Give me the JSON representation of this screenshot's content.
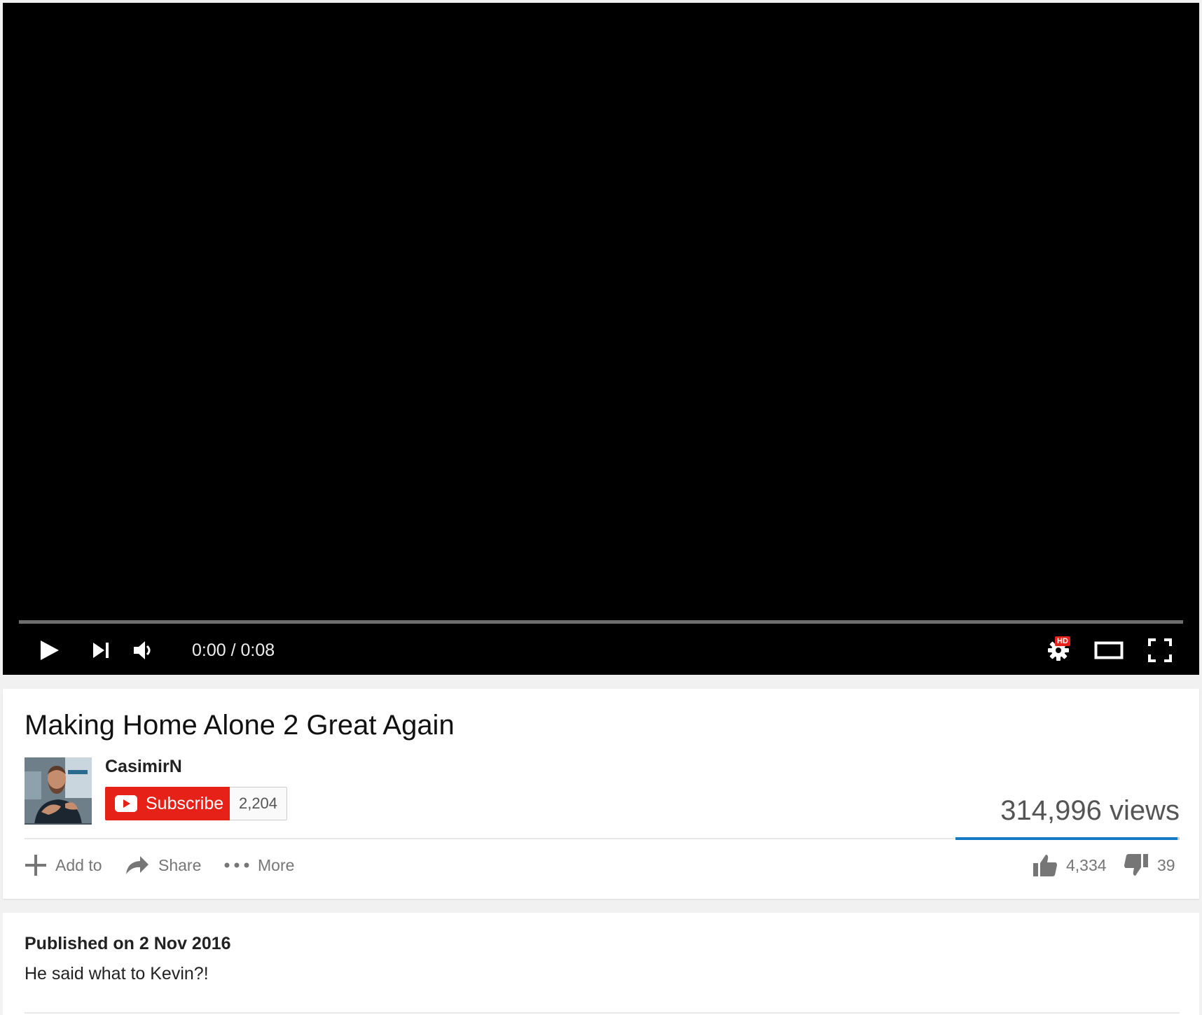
{
  "player": {
    "time_display": "0:00 / 0:08",
    "progress_fraction": 0,
    "hd_badge": "HD",
    "icons": {
      "play": "play-icon",
      "next": "next-icon",
      "volume": "volume-icon",
      "settings": "settings-gear-icon",
      "theater": "theater-mode-icon",
      "fullscreen": "fullscreen-icon"
    }
  },
  "video": {
    "title": "Making Home Alone 2 Great Again",
    "channel_name": "CasimirN",
    "subscribe_label": "Subscribe",
    "subscriber_count": "2,204",
    "view_count": "314,996 views",
    "like_count": "4,334",
    "dislike_count": "39",
    "like_fraction": 0.991
  },
  "actions": {
    "add_to": "Add to",
    "share": "Share",
    "more": "More"
  },
  "description": {
    "published": "Published on 2 Nov 2016",
    "text": "He said what to Kevin?!"
  },
  "colors": {
    "subscribe_red": "#e62117",
    "sentiment_blue": "#167ac6",
    "player_bg": "#000000"
  }
}
